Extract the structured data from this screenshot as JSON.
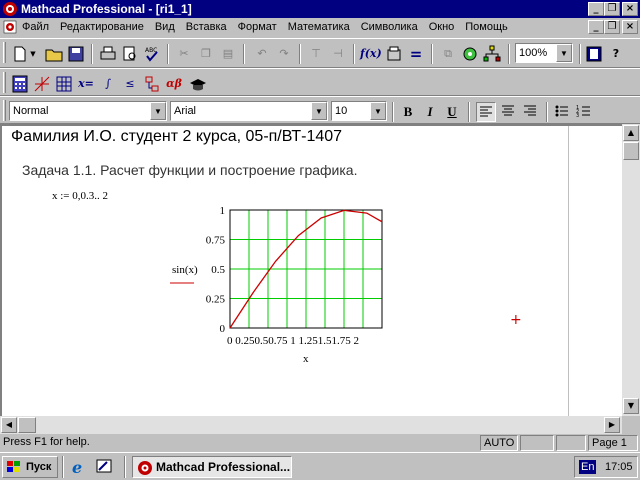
{
  "window": {
    "title": "Mathcad Professional - [ri1_1]",
    "buttons": {
      "minimize": "_",
      "restore": "❐",
      "close": "×"
    }
  },
  "menu": {
    "items": [
      "Файл",
      "Редактирование",
      "Вид",
      "Вставка",
      "Формат",
      "Математика",
      "Символика",
      "Окно",
      "Помощь"
    ]
  },
  "toolbar": {
    "zoom": "100%",
    "style": "Normal",
    "font": "Arial",
    "size": "10",
    "bold": "B",
    "italic": "I",
    "underline": "U"
  },
  "document": {
    "heading": "Фамилия И.О. студент 2 курса, 05-п/ВТ-1407",
    "task": "Задача 1.1. Расчет функции и построение графика.",
    "definition": "x := 0,0.3.. 2",
    "cursor": "+"
  },
  "chart_data": {
    "type": "line",
    "series": [
      {
        "x": [
          0,
          0.3,
          0.6,
          0.9,
          1.2,
          1.5,
          1.8,
          2.1
        ],
        "y": [
          0,
          0.296,
          0.565,
          0.783,
          0.932,
          0.997,
          0.974,
          0.863
        ]
      }
    ],
    "xlabel": "x",
    "ylabel": "sin(x)",
    "xlim": [
      0,
      2
    ],
    "ylim": [
      0,
      1
    ],
    "xticks": [
      "0",
      "0.25",
      "0.5",
      "0.75",
      "1",
      "1.25",
      "1.5",
      "1.75",
      "2"
    ],
    "yticks": [
      "0",
      "0.25",
      "0.5",
      "0.75",
      "1"
    ],
    "grid": true,
    "grid_color": "#00cc00",
    "line_color": "#cc0000"
  },
  "status": {
    "help": "Press F1 for help.",
    "mode": "AUTO",
    "page": "Page 1"
  },
  "taskbar": {
    "start": "Пуск",
    "task": "Mathcad Professional...",
    "lang": "En",
    "time": "17:05"
  }
}
